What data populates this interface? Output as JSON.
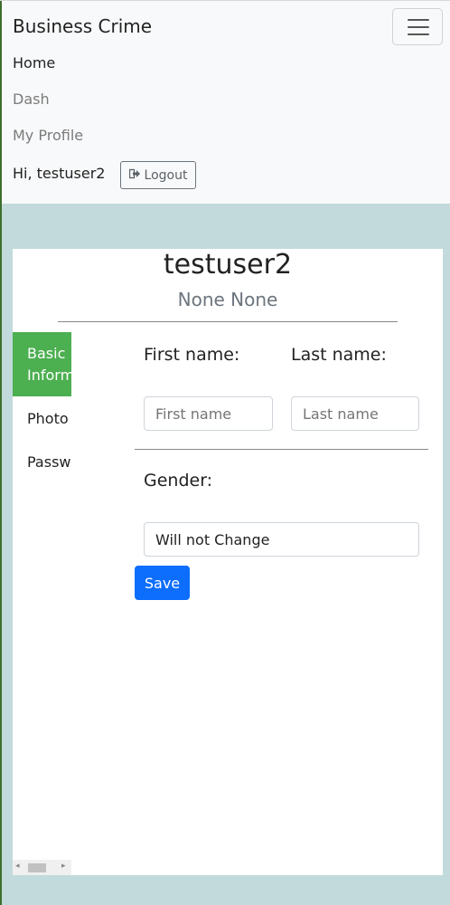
{
  "navbar": {
    "brand": "Business Crime",
    "links": [
      "Home",
      "Dash",
      "My Profile"
    ],
    "greeting": "Hi, testuser2",
    "logout_label": "Logout",
    "icons": {
      "toggler": "hamburger-icon",
      "logout": "sign-out-icon"
    }
  },
  "profile": {
    "username": "testuser2",
    "full_name": "None None",
    "tabs": [
      "Basic Information",
      "Photo",
      "Password"
    ],
    "form": {
      "first_name_label": "First name:",
      "last_name_label": "Last name:",
      "first_name_placeholder": "First name",
      "last_name_placeholder": "Last name",
      "gender_label": "Gender:",
      "gender_value": "Will not Change",
      "save_label": "Save"
    }
  },
  "colors": {
    "page_bg": "#c2dadb",
    "navbar_bg": "#f8f9fa",
    "active_tab": "#4caf50",
    "primary_button": "#0d6efd"
  }
}
